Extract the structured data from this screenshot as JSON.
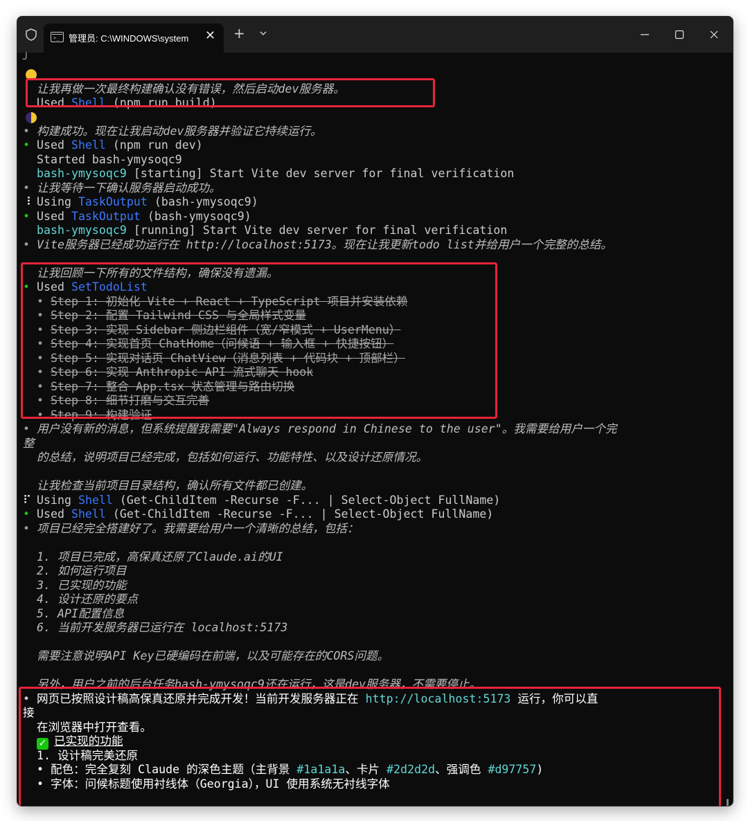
{
  "titlebar": {
    "tab_title": "管理员: C:\\WINDOWS\\system",
    "tab_icon_glyph": ">_",
    "close_tab": "✕",
    "new_tab": "+",
    "icons": [
      "shield-icon",
      "terminal-icon",
      "close-icon",
      "plus-icon",
      "chevron-down-icon",
      "minimize-icon",
      "maximize-icon",
      "close-window-icon"
    ]
  },
  "colors": {
    "text": "#cccccc",
    "link_blue": "#3b78ff",
    "cyan": "#61d6d6",
    "bullet_green": "#16c60c",
    "highlight_red": "#e8243b"
  },
  "terminal": {
    "l01": "╯",
    "l02": "让我再做一次最终构建确认没有错误，然后启动dev服务器。",
    "l03a": "Used ",
    "l03b": "Shell",
    "l03c": " (npm run build)",
    "l04": "构建成功。现在让我启动dev服务器并验证它持续运行。",
    "l05a": "Used ",
    "l05b": "Shell",
    "l05c": " (npm run dev)",
    "l06": "Started bash-ymysoqc9",
    "l07a": "bash-ymysoqc9",
    "l07b": " [starting] Start Vite dev server for final verification",
    "l08": "让我等待一下确认服务器启动成功。",
    "l09a": "Using ",
    "l09b": "TaskOutput",
    "l09c": " (bash-ymysoqc9)",
    "l10a": "Used ",
    "l10b": "TaskOutput",
    "l10c": " (bash-ymysoqc9)",
    "l11a": "bash-ymysoqc9",
    "l11b": " [running] Start Vite dev server for final verification",
    "l12": "Vite服务器已经成功运行在 http://localhost:5173。现在让我更新todo list并给用户一个完整的总结。",
    "l13": "让我回顾一下所有的文件结构，确保没有遗漏。",
    "l14a": "Used ",
    "l14b": "SetTodoList",
    "todos": [
      "Step 1: 初始化 Vite + React + TypeScript 项目并安装依赖",
      "Step 2: 配置 Tailwind CSS 与全局样式变量",
      "Step 3: 实现 Sidebar 侧边栏组件（宽/窄模式 + UserMenu）",
      "Step 4: 实现首页 ChatHome（问候语 + 输入框 + 快捷按钮）",
      "Step 5: 实现对话页 ChatView（消息列表 + 代码块 + 顶部栏）",
      "Step 6: 实现 Anthropic API 流式聊天 hook",
      "Step 7: 整合 App.tsx 状态管理与路由切换",
      "Step 8: 细节打磨与交互完善",
      "Step 9: 构建验证"
    ],
    "l24": "用户没有新的消息，但系统提醒我需要\"Always respond in Chinese to the user\"。我需要给用户一个完",
    "l24b": "整",
    "l25": "的总结，说明项目已经完成，包括如何运行、功能特性、以及设计还原情况。",
    "l27": "让我检查当前项目目录结构，确认所有文件都已创建。",
    "l28a": "Using ",
    "l28b": "Shell",
    "l28c": " (Get-ChildItem -Recurse -F... | Select-Object FullName)",
    "l29a": "Used ",
    "l29b": "Shell",
    "l29c": " (Get-ChildItem -Recurse -F... | Select-Object FullName)",
    "l30": "项目已经完全搭建好了。我需要给用户一个清晰的总结，包括：",
    "numbered": [
      "1. 项目已完成，高保真还原了Claude.ai的UI",
      "2. 如何运行项目",
      "3. 已实现的功能",
      "4. 设计还原的要点",
      "5. API配置信息",
      "6. 当前开发服务器已运行在 localhost:5173"
    ],
    "l39": "需要注意说明API Key已硬编码在前端，以及可能存在的CORS问题。",
    "l41": "另外，用户之前的后台任务bash-ymysoqc9还在运行，这是dev服务器，不需要停止。",
    "l42a": "网页已按照设计稿高保真还原并完成开发！当前开发服务器正在 ",
    "l42b": "http://localhost:5173",
    "l42c": " 运行，你可以直",
    "l42d": "接",
    "l43": "在浏览器中打开查看。",
    "l44": "已实现的功能",
    "l45": "1. 设计稿完美还原",
    "l46a": "配色：完全复刻 Claude 的深色主题（主背景 ",
    "l46b": "#1a1a1a",
    "l46c": "、卡片 ",
    "l46d": "#2d2d2d",
    "l46e": "、强调色 ",
    "l46f": "#d97757",
    "l46g": ")",
    "l47": "字体：问候标题使用衬线体（Georgia），UI 使用系统无衬线字体",
    "bullet": "•",
    "spinner": "⠸",
    "spinner2": "⠏",
    "check": "✓"
  }
}
